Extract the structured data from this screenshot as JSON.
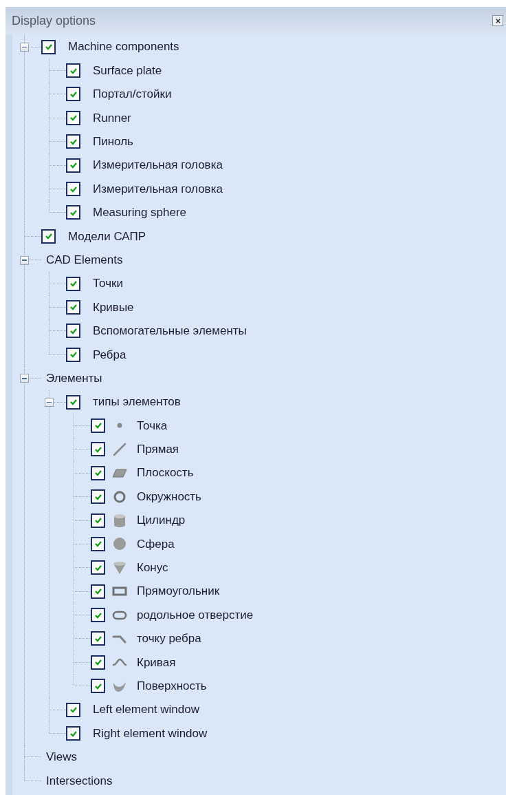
{
  "panel": {
    "title": "Display options"
  },
  "tree": [
    {
      "label": "Machine components",
      "checked": true,
      "expanded": true,
      "children": [
        {
          "label": "Surface plate",
          "checked": true
        },
        {
          "label": "Портал/стойки",
          "checked": true
        },
        {
          "label": "Runner",
          "checked": true
        },
        {
          "label": "Пиноль",
          "checked": true
        },
        {
          "label": "Измерительная головка",
          "checked": true
        },
        {
          "label": "Измерительная головка",
          "checked": true
        },
        {
          "label": "Measuring sphere",
          "checked": true
        }
      ]
    },
    {
      "label": "Модели САПР",
      "checked": true
    },
    {
      "label": "CAD Elements",
      "expanded": true,
      "children": [
        {
          "label": "Точки",
          "checked": true
        },
        {
          "label": "Кривые",
          "checked": true
        },
        {
          "label": "Вспомогательные элементы",
          "checked": true
        },
        {
          "label": "Ребра",
          "checked": true
        }
      ]
    },
    {
      "label": "Элементы",
      "expanded": true,
      "children": [
        {
          "label": "типы элементов",
          "checked": true,
          "expanded": true,
          "children": [
            {
              "label": "Точка",
              "checked": true,
              "kind": "point"
            },
            {
              "label": "Прямая",
              "checked": true,
              "kind": "line"
            },
            {
              "label": "Плоскость",
              "checked": true,
              "kind": "plane"
            },
            {
              "label": "Окружность",
              "checked": true,
              "kind": "circle"
            },
            {
              "label": "Цилиндр",
              "checked": true,
              "kind": "cylinder"
            },
            {
              "label": "Сфера",
              "checked": true,
              "kind": "sphere"
            },
            {
              "label": "Конус",
              "checked": true,
              "kind": "cone"
            },
            {
              "label": "Прямоугольник",
              "checked": true,
              "kind": "rectangle"
            },
            {
              "label": "родольное отверстие",
              "checked": true,
              "kind": "slot"
            },
            {
              "label": "точку ребра",
              "checked": true,
              "kind": "edge"
            },
            {
              "label": "Кривая",
              "checked": true,
              "kind": "curve"
            },
            {
              "label": "Поверхность",
              "checked": true,
              "kind": "surface"
            }
          ]
        },
        {
          "label": "Left element window",
          "checked": true
        },
        {
          "label": "Right element window",
          "checked": true
        }
      ]
    },
    {
      "label": "Views"
    },
    {
      "label": "Intersections"
    }
  ]
}
